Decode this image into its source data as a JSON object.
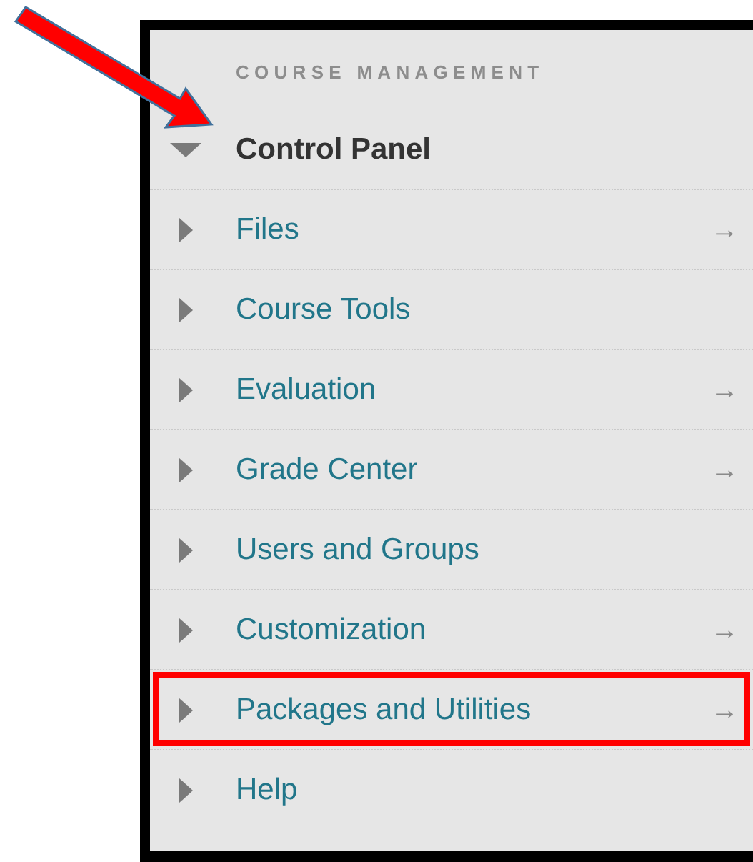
{
  "heading": "COURSE MANAGEMENT",
  "section": {
    "title": "Control Panel",
    "expanded": true
  },
  "items": [
    {
      "label": "Files",
      "expanded": false,
      "arrow": "→",
      "highlighted": false
    },
    {
      "label": "Course Tools",
      "expanded": false,
      "highlighted": false
    },
    {
      "label": "Evaluation",
      "expanded": false,
      "arrow": "→",
      "highlighted": false
    },
    {
      "label": "Grade Center",
      "expanded": false,
      "arrow": "→",
      "highlighted": false
    },
    {
      "label": "Users and Groups",
      "expanded": false,
      "highlighted": false
    },
    {
      "label": "Customization",
      "expanded": false,
      "arrow": "→",
      "highlighted": false
    },
    {
      "label": "Packages and Utilities",
      "expanded": false,
      "arrow": "→",
      "highlighted": true
    },
    {
      "label": "Help",
      "expanded": false,
      "highlighted": false
    }
  ]
}
